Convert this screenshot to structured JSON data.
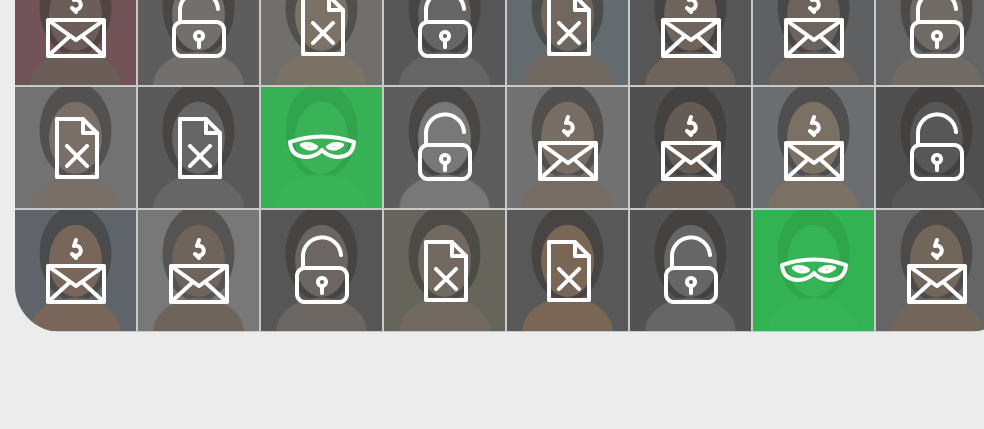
{
  "grid": {
    "rows": [
      [
        {
          "icon": "phishing-email-icon",
          "bg": "#a8666f",
          "tone": "#9a7d71",
          "state": "default"
        },
        {
          "icon": "unlocked-padlock-icon",
          "bg": "#7b7b7b",
          "tone": "#aaa39b",
          "state": "default"
        },
        {
          "icon": "blocked-file-icon",
          "bg": "#a5a39a",
          "tone": "#bda88f",
          "state": "default"
        },
        {
          "icon": "unlocked-padlock-icon",
          "bg": "#6e6e6e",
          "tone": "#8c8c8c",
          "state": "default"
        },
        {
          "icon": "blocked-file-icon",
          "bg": "#8a9aa3",
          "tone": "#a5907e",
          "state": "default"
        },
        {
          "icon": "phishing-email-icon",
          "bg": "#6a6a6a",
          "tone": "#a08a77",
          "state": "default"
        },
        {
          "icon": "phishing-email-icon",
          "bg": "#7d8083",
          "tone": "#9a8878",
          "state": "default"
        },
        {
          "icon": "unlocked-padlock-icon",
          "bg": "#8c8c8c",
          "tone": "#a7998c",
          "state": "default"
        }
      ],
      [
        {
          "icon": "blocked-file-icon",
          "bg": "#a9a9a9",
          "tone": "#b6a392",
          "state": "default"
        },
        {
          "icon": "blocked-file-icon",
          "bg": "#727272",
          "tone": "#8f8f8f",
          "state": "default"
        },
        {
          "icon": "mask-icon",
          "bg": "#5fa06c",
          "tone": "#6fae7b",
          "state": "highlight"
        },
        {
          "icon": "unlocked-padlock-icon",
          "bg": "#7a7a7a",
          "tone": "#b5b5b5",
          "state": "default"
        },
        {
          "icon": "phishing-email-icon",
          "bg": "#a6a6a6",
          "tone": "#b49d8c",
          "state": "default"
        },
        {
          "icon": "phishing-email-icon",
          "bg": "#5e5e5e",
          "tone": "#8a7566",
          "state": "default"
        },
        {
          "icon": "phishing-email-icon",
          "bg": "#9a9fa6",
          "tone": "#bba68b",
          "state": "default"
        },
        {
          "icon": "unlocked-padlock-icon",
          "bg": "#5c5c5c",
          "tone": "#6d6d6d",
          "state": "default"
        }
      ],
      [
        {
          "icon": "phishing-email-icon",
          "bg": "#7f8b9a",
          "tone": "#b48f72",
          "state": "default"
        },
        {
          "icon": "phishing-email-icon",
          "bg": "#b7b7b7",
          "tone": "#9f8a78",
          "state": "default"
        },
        {
          "icon": "unlocked-padlock-icon",
          "bg": "#6b6b6b",
          "tone": "#9a8f86",
          "state": "default"
        },
        {
          "icon": "blocked-file-icon",
          "bg": "#8f8d78",
          "tone": "#a89680",
          "state": "default"
        },
        {
          "icon": "blocked-file-icon",
          "bg": "#6f6f6f",
          "tone": "#b88e66",
          "state": "default"
        },
        {
          "icon": "unlocked-padlock-icon",
          "bg": "#626262",
          "tone": "#8e8e8e",
          "state": "default"
        },
        {
          "icon": "mask-icon",
          "bg": "#43a75a",
          "tone": "#55b06a",
          "state": "highlight"
        },
        {
          "icon": "phishing-email-icon",
          "bg": "#8d8d8d",
          "tone": "#a88e75",
          "state": "default"
        }
      ]
    ]
  },
  "colors": {
    "page_background": "#ececec",
    "highlight_green": "#2eb450",
    "icon_stroke": "#ffffff"
  }
}
